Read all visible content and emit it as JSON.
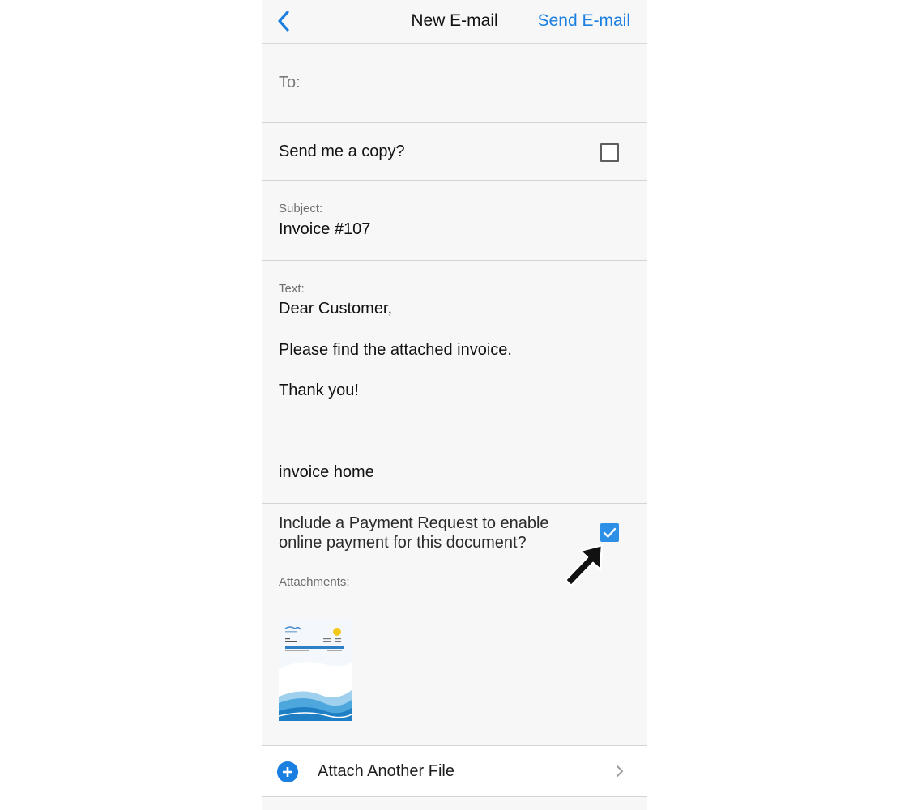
{
  "navbar": {
    "title": "New E-mail",
    "action_label": "Send E-mail",
    "back_icon": "chevron-left-icon"
  },
  "to": {
    "label": "To:"
  },
  "copy": {
    "label": "Send me a copy?",
    "checked": false
  },
  "subject": {
    "label": "Subject:",
    "value": "Invoice #107"
  },
  "text": {
    "label": "Text:",
    "line1": "Dear Customer,",
    "line2": "Please find the attached invoice.",
    "line3": "Thank you!",
    "signature": "invoice home"
  },
  "payment": {
    "label": "Include a Payment Request to enable online payment for this document?",
    "checked": true
  },
  "attachments": {
    "label": "Attachments:",
    "thumbnail_icon": "invoice-thumbnail"
  },
  "attach_row": {
    "label": "Attach Another File",
    "icon": "plus-circle-icon",
    "chevron": "chevron-right-icon"
  },
  "colors": {
    "accent": "#1a7fe0",
    "checkbox_checked": "#2e8fe6",
    "background": "#f7f7f7"
  }
}
